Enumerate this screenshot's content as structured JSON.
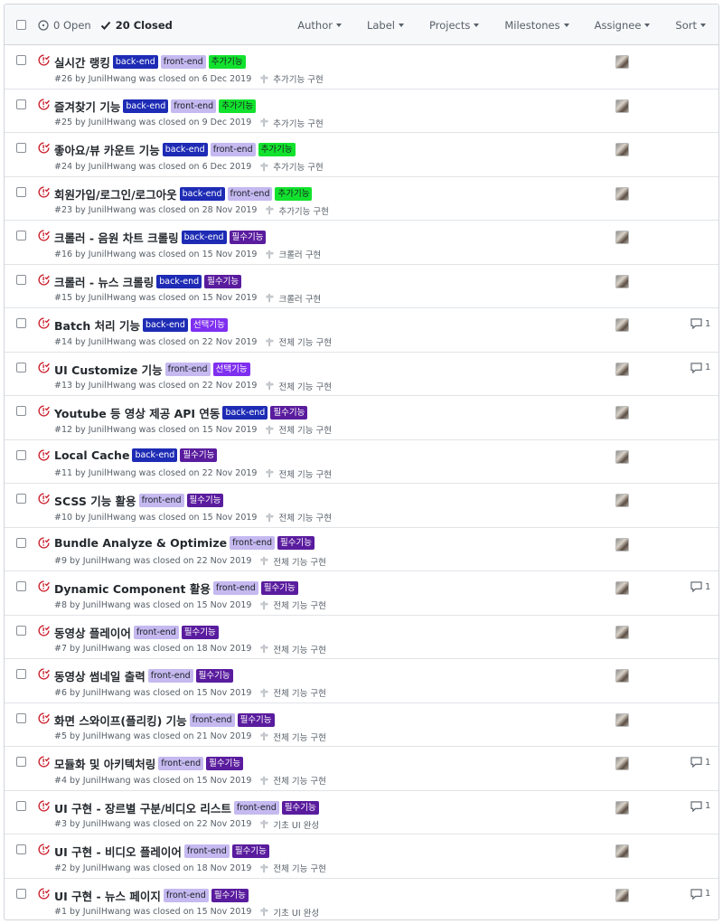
{
  "header": {
    "open_label": "0 Open",
    "closed_label": "20 Closed",
    "filters": [
      "Author",
      "Label",
      "Projects",
      "Milestones",
      "Assignee",
      "Sort"
    ]
  },
  "colors": {
    "closed_icon": "#cb2431",
    "label_back_end": "#1d2bb5",
    "label_front_end": "#c5b9f0",
    "label_add_feature": "#12e22d",
    "label_required": "#5a1c9e",
    "label_optional": "#7f2ff0"
  },
  "issues": [
    {
      "title": "실시간 랭킹",
      "labels": [
        {
          "text": "back-end",
          "kind": "back"
        },
        {
          "text": "front-end",
          "kind": "front"
        },
        {
          "text": "추가기능",
          "kind": "add"
        }
      ],
      "meta": "#26 by JunilHwang was closed on 6 Dec 2019",
      "milestone": "추가기능 구현",
      "comments": ""
    },
    {
      "title": "즐겨찾기 기능",
      "labels": [
        {
          "text": "back-end",
          "kind": "back"
        },
        {
          "text": "front-end",
          "kind": "front"
        },
        {
          "text": "추가기능",
          "kind": "add"
        }
      ],
      "meta": "#25 by JunilHwang was closed on 9 Dec 2019",
      "milestone": "추가기능 구현",
      "comments": ""
    },
    {
      "title": "좋아요/뷰 카운트 기능",
      "labels": [
        {
          "text": "back-end",
          "kind": "back"
        },
        {
          "text": "front-end",
          "kind": "front"
        },
        {
          "text": "추가기능",
          "kind": "add"
        }
      ],
      "meta": "#24 by JunilHwang was closed on 6 Dec 2019",
      "milestone": "추가기능 구현",
      "comments": ""
    },
    {
      "title": "회원가입/로그인/로그아웃",
      "labels": [
        {
          "text": "back-end",
          "kind": "back"
        },
        {
          "text": "front-end",
          "kind": "front"
        },
        {
          "text": "추가기능",
          "kind": "add"
        }
      ],
      "meta": "#23 by JunilHwang was closed on 28 Nov 2019",
      "milestone": "추가기능 구현",
      "comments": ""
    },
    {
      "title": "크롤러 - 음원 차트 크롤링",
      "labels": [
        {
          "text": "back-end",
          "kind": "back"
        },
        {
          "text": "필수기능",
          "kind": "req"
        }
      ],
      "meta": "#16 by JunilHwang was closed on 15 Nov 2019",
      "milestone": "크롤러 구현",
      "comments": ""
    },
    {
      "title": "크롤러 - 뉴스 크롤링",
      "labels": [
        {
          "text": "back-end",
          "kind": "back"
        },
        {
          "text": "필수기능",
          "kind": "req"
        }
      ],
      "meta": "#15 by JunilHwang was closed on 15 Nov 2019",
      "milestone": "크롤러 구현",
      "comments": ""
    },
    {
      "title": "Batch 처리 기능",
      "labels": [
        {
          "text": "back-end",
          "kind": "back"
        },
        {
          "text": "선택기능",
          "kind": "opt"
        }
      ],
      "meta": "#14 by JunilHwang was closed on 22 Nov 2019",
      "milestone": "전체 기능 구현",
      "comments": "1"
    },
    {
      "title": "UI Customize 기능",
      "labels": [
        {
          "text": "front-end",
          "kind": "front"
        },
        {
          "text": "선택기능",
          "kind": "opt"
        }
      ],
      "meta": "#13 by JunilHwang was closed on 22 Nov 2019",
      "milestone": "전체 기능 구현",
      "comments": "1"
    },
    {
      "title": "Youtube 등 영상 제공 API 연동",
      "labels": [
        {
          "text": "back-end",
          "kind": "back"
        },
        {
          "text": "필수기능",
          "kind": "req"
        }
      ],
      "meta": "#12 by JunilHwang was closed on 15 Nov 2019",
      "milestone": "전체 기능 구현",
      "comments": ""
    },
    {
      "title": "Local Cache",
      "labels": [
        {
          "text": "back-end",
          "kind": "back"
        },
        {
          "text": "필수기능",
          "kind": "req"
        }
      ],
      "meta": "#11 by JunilHwang was closed on 22 Nov 2019",
      "milestone": "전체 기능 구현",
      "comments": ""
    },
    {
      "title": "SCSS 기능 활용",
      "labels": [
        {
          "text": "front-end",
          "kind": "front"
        },
        {
          "text": "필수기능",
          "kind": "req"
        }
      ],
      "meta": "#10 by JunilHwang was closed on 15 Nov 2019",
      "milestone": "전체 기능 구현",
      "comments": ""
    },
    {
      "title": "Bundle Analyze & Optimize",
      "labels": [
        {
          "text": "front-end",
          "kind": "front"
        },
        {
          "text": "필수기능",
          "kind": "req"
        }
      ],
      "meta": "#9 by JunilHwang was closed on 22 Nov 2019",
      "milestone": "전체 기능 구현",
      "comments": ""
    },
    {
      "title": "Dynamic Component 활용",
      "labels": [
        {
          "text": "front-end",
          "kind": "front"
        },
        {
          "text": "필수기능",
          "kind": "req"
        }
      ],
      "meta": "#8 by JunilHwang was closed on 15 Nov 2019",
      "milestone": "전체 기능 구현",
      "comments": "1"
    },
    {
      "title": "동영상 플레이어",
      "labels": [
        {
          "text": "front-end",
          "kind": "front"
        },
        {
          "text": "필수기능",
          "kind": "req"
        }
      ],
      "meta": "#7 by JunilHwang was closed on 18 Nov 2019",
      "milestone": "전체 기능 구현",
      "comments": ""
    },
    {
      "title": "동영상 썸네일 출력",
      "labels": [
        {
          "text": "front-end",
          "kind": "front"
        },
        {
          "text": "필수기능",
          "kind": "req"
        }
      ],
      "meta": "#6 by JunilHwang was closed on 15 Nov 2019",
      "milestone": "전체 기능 구현",
      "comments": ""
    },
    {
      "title": "화면 스와이프(플리킹) 기능",
      "labels": [
        {
          "text": "front-end",
          "kind": "front"
        },
        {
          "text": "필수기능",
          "kind": "req"
        }
      ],
      "meta": "#5 by JunilHwang was closed on 21 Nov 2019",
      "milestone": "전체 기능 구현",
      "comments": ""
    },
    {
      "title": "모듈화 및 아키텍처링",
      "labels": [
        {
          "text": "front-end",
          "kind": "front"
        },
        {
          "text": "필수기능",
          "kind": "req"
        }
      ],
      "meta": "#4 by JunilHwang was closed on 15 Nov 2019",
      "milestone": "전체 기능 구현",
      "comments": "1"
    },
    {
      "title": "UI 구현 - 장르별 구분/비디오 리스트",
      "labels": [
        {
          "text": "front-end",
          "kind": "front"
        },
        {
          "text": "필수기능",
          "kind": "req"
        }
      ],
      "meta": "#3 by JunilHwang was closed on 22 Nov 2019",
      "milestone": "기초 UI 완성",
      "comments": "1"
    },
    {
      "title": "UI 구현 - 비디오 플레이어",
      "labels": [
        {
          "text": "front-end",
          "kind": "front"
        },
        {
          "text": "필수기능",
          "kind": "req"
        }
      ],
      "meta": "#2 by JunilHwang was closed on 18 Nov 2019",
      "milestone": "전체 기능 구현",
      "comments": ""
    },
    {
      "title": "UI 구현 - 뉴스 페이지",
      "labels": [
        {
          "text": "front-end",
          "kind": "front"
        },
        {
          "text": "필수기능",
          "kind": "req"
        }
      ],
      "meta": "#1 by JunilHwang was closed on 15 Nov 2019",
      "milestone": "기초 UI 완성",
      "comments": "1"
    }
  ]
}
